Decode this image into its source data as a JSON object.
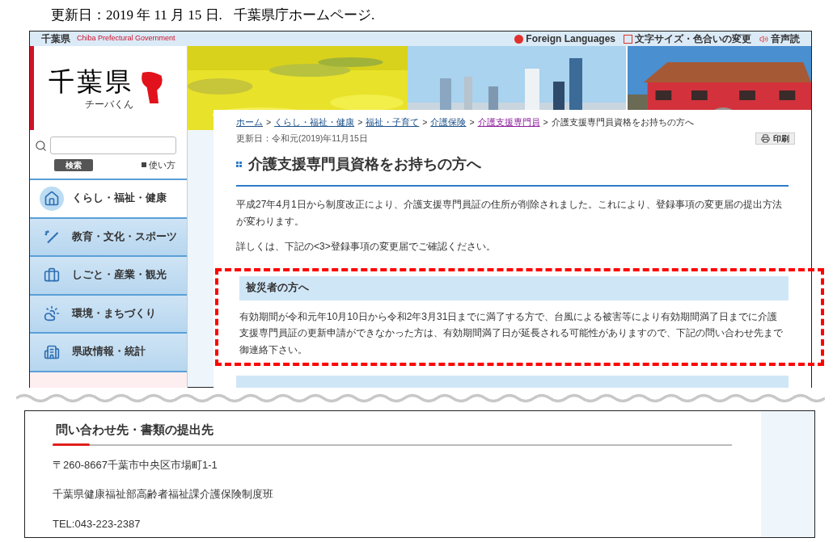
{
  "caption": {
    "date": "更新日：2019 年 11 月 15 日.",
    "source": "千葉県庁ホームページ."
  },
  "header": {
    "site_name": "千葉県",
    "site_name_en": "Chiba Prefectural Government",
    "links": [
      "Foreign Languages",
      "文字サイズ・色合いの変更",
      "音声読"
    ]
  },
  "logo": {
    "title": "千葉県",
    "mascot_caption": "チーバくん"
  },
  "search": {
    "button": "検索",
    "help_link": "使い方"
  },
  "nav": [
    {
      "label": "くらし・福祉・健康",
      "selected": true
    },
    {
      "label": "教育・文化・スポーツ",
      "selected": false
    },
    {
      "label": "しごと・産業・観光",
      "selected": false
    },
    {
      "label": "環境・まちづくり",
      "selected": false
    },
    {
      "label": "県政情報・統計",
      "selected": false
    }
  ],
  "breadcrumb": [
    {
      "label": "ホーム",
      "kind": "link",
      "visited": false
    },
    {
      "label": ">",
      "kind": "separator"
    },
    {
      "label": "くらし・福祉・健康",
      "kind": "link",
      "visited": false
    },
    {
      "label": ">",
      "kind": "separator"
    },
    {
      "label": "福祉・子育て",
      "kind": "link",
      "visited": false
    },
    {
      "label": ">",
      "kind": "separator"
    },
    {
      "label": "介護保険",
      "kind": "link",
      "visited": false
    },
    {
      "label": ">",
      "kind": "separator"
    },
    {
      "label": "介護支援専門員",
      "kind": "link",
      "visited": true
    },
    {
      "label": ">",
      "kind": "separator"
    },
    {
      "label": "介護支援専門員資格をお持ちの方へ",
      "kind": "current"
    }
  ],
  "updated": "更新日：令和元(2019)年11月15日",
  "print_button": "印刷",
  "title": "介護支援専門員資格をお持ちの方へ",
  "paragraphs": [
    "平成27年4月1日から制度改正により、介護支援専門員証の住所が削除されました。これにより、登録事項の変更届の提出方法が変わります。",
    "詳しくは、下記の<3>登録事項の変更届でご確認ください。"
  ],
  "notice": {
    "heading": "被災者の方へ",
    "text": "有効期間が令和元年10月10日から令和2年3月31日までに満了する方で、台風による被害等により有効期間満了日までに介護支援専門員証の更新申請ができなかった方は、有効期間満了日が延長される可能性がありますので、下記の問い合わせ先まで御連絡下さい。",
    "highlighted": true
  },
  "contact": {
    "heading": "問い合わせ先・書類の提出先",
    "lines": [
      "〒260-8667千葉市中央区市場町1-1",
      "千葉県健康福祉部高齢者福祉課介護保険制度班",
      "TEL:043-223-2387"
    ]
  }
}
